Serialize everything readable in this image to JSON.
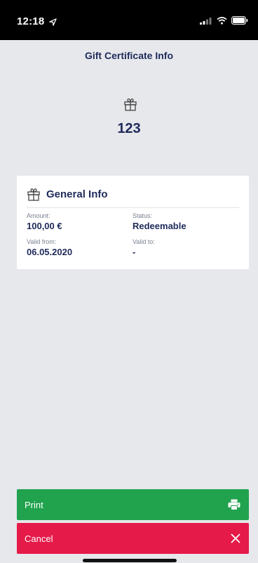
{
  "status_bar": {
    "time": "12:18"
  },
  "header": {
    "title": "Gift Certificate Info"
  },
  "certificate": {
    "number": "123"
  },
  "general_info": {
    "title": "General Info",
    "amount_label": "Amount:",
    "amount_value": "100,00 €",
    "status_label": "Status:",
    "status_value": "Redeemable",
    "valid_from_label": "Valid from:",
    "valid_from_value": "06.05.2020",
    "valid_to_label": "Valid to:",
    "valid_to_value": "-"
  },
  "actions": {
    "print_label": "Print",
    "cancel_label": "Cancel"
  },
  "colors": {
    "primary": "#1f2a5a",
    "print": "#21a34e",
    "cancel": "#e51a49",
    "background": "#e6e8ec"
  }
}
